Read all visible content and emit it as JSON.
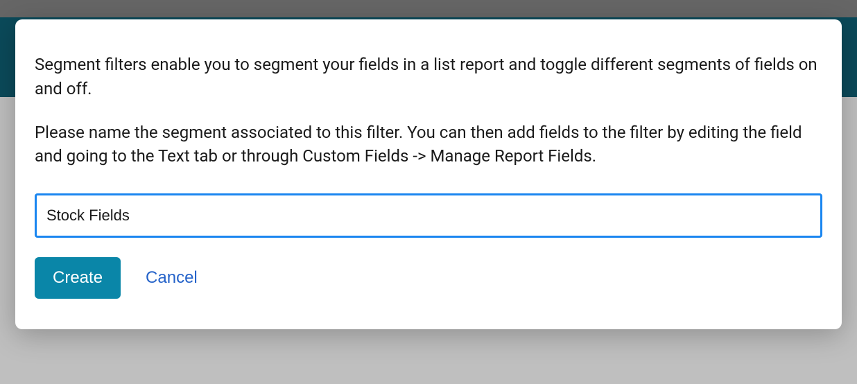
{
  "modal": {
    "paragraph1": "Segment filters enable you to segment your fields in a list report and toggle different segments of fields on and off.",
    "paragraph2": "Please name the segment associated to this filter. You can then add fields to the filter by editing the field and going to the Text tab or through Custom Fields -> Manage Report Fields.",
    "input_value": "Stock Fields",
    "create_label": "Create",
    "cancel_label": "Cancel"
  }
}
